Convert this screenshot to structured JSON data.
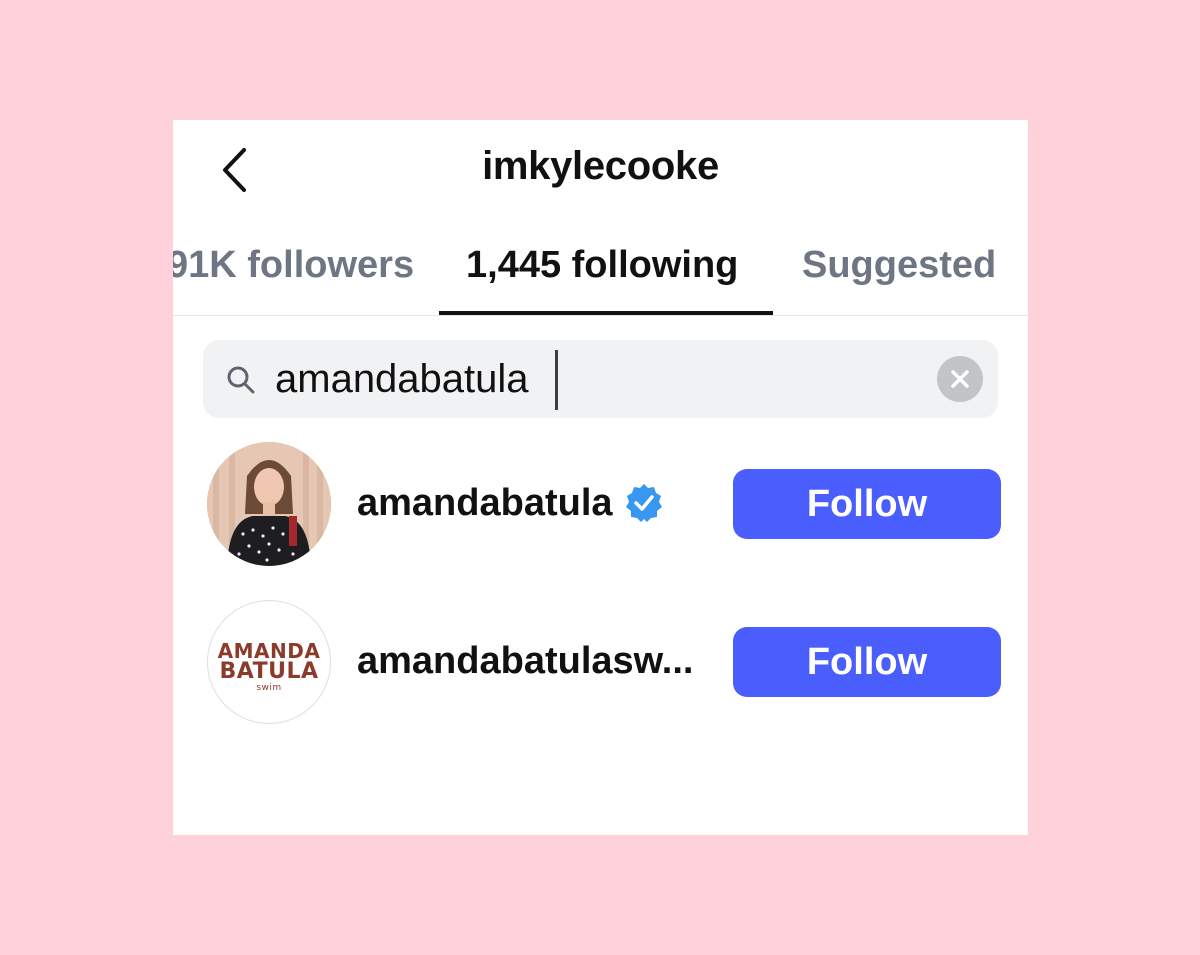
{
  "header": {
    "title": "imkylecooke",
    "back_icon": "chevron-left-icon"
  },
  "tabs": [
    {
      "label": "91K followers",
      "active": false
    },
    {
      "label": "1,445 following",
      "active": true
    },
    {
      "label": "Suggested",
      "active": false
    }
  ],
  "search": {
    "value": "amandabatula",
    "icon": "search-icon",
    "clear_icon": "clear-icon"
  },
  "results": [
    {
      "username": "amandabatula",
      "verified": true,
      "avatar": "profile-photo",
      "action_label": "Follow"
    },
    {
      "username": "amandabatulasw...",
      "verified": false,
      "avatar": "brand-logo",
      "avatar_logo_lines": [
        "AMANDA",
        "BATULA",
        "swim"
      ],
      "action_label": "Follow"
    }
  ],
  "colors": {
    "page_background": "#ffd1db",
    "follow_button": "#4a5dfd",
    "verified_badge": "#3897f0",
    "logo_text": "#8c3b2b"
  }
}
